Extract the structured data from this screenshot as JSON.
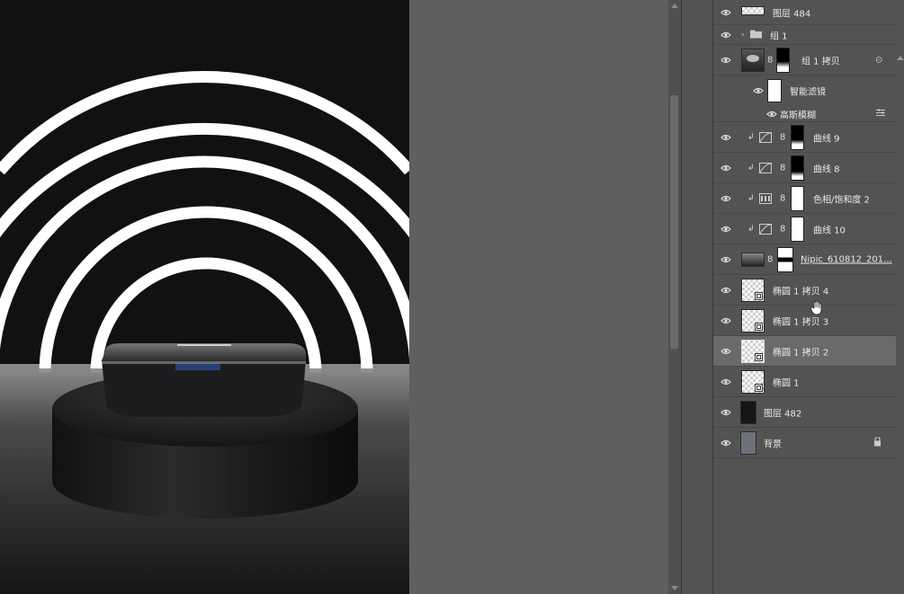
{
  "canvas": {
    "background": "#101111",
    "ring_color": "#ffffff",
    "floor_tone": "#3a3a3a"
  },
  "scrollbar": {
    "thumb_color": "#6b6b6b"
  },
  "layers": [
    {
      "id": "layer-484",
      "name": "图层 484",
      "kind": "pixel-strip",
      "visible": true
    },
    {
      "id": "group-1",
      "name": "组 1",
      "kind": "group",
      "visible": true
    },
    {
      "id": "group-1-copy",
      "name": "组 1 拷贝",
      "kind": "smart-object",
      "visible": true
    },
    {
      "id": "smart-filters",
      "name": "智能滤镜",
      "kind": "smart-filters",
      "visible": true
    },
    {
      "id": "gaussian-blur",
      "name": "高斯模糊",
      "kind": "filter",
      "visible": true
    },
    {
      "id": "curves-9",
      "name": "曲线 9",
      "kind": "curves",
      "visible": true
    },
    {
      "id": "curves-8",
      "name": "曲线 8",
      "kind": "curves",
      "visible": true
    },
    {
      "id": "hue-sat-2",
      "name": "色相/饱和度 2",
      "kind": "hue-saturation",
      "visible": true
    },
    {
      "id": "curves-10",
      "name": "曲线 10",
      "kind": "curves",
      "visible": true
    },
    {
      "id": "nipic",
      "name": "Nipic_610812_201...",
      "kind": "image-linked",
      "visible": true
    },
    {
      "id": "ellipse-copy-4",
      "name": "椭圆 1 拷贝 4",
      "kind": "shape",
      "visible": true
    },
    {
      "id": "ellipse-copy-3",
      "name": "椭圆 1 拷贝 3",
      "kind": "shape",
      "visible": true
    },
    {
      "id": "ellipse-copy-2",
      "name": "椭圆 1 拷贝 2",
      "kind": "shape",
      "visible": true,
      "selected": true
    },
    {
      "id": "ellipse-1",
      "name": "椭圆 1",
      "kind": "shape",
      "visible": true
    },
    {
      "id": "layer-482",
      "name": "图层 482",
      "kind": "pixel-dark",
      "visible": true
    },
    {
      "id": "background",
      "name": "背景",
      "kind": "background",
      "visible": true,
      "locked": true
    }
  ]
}
